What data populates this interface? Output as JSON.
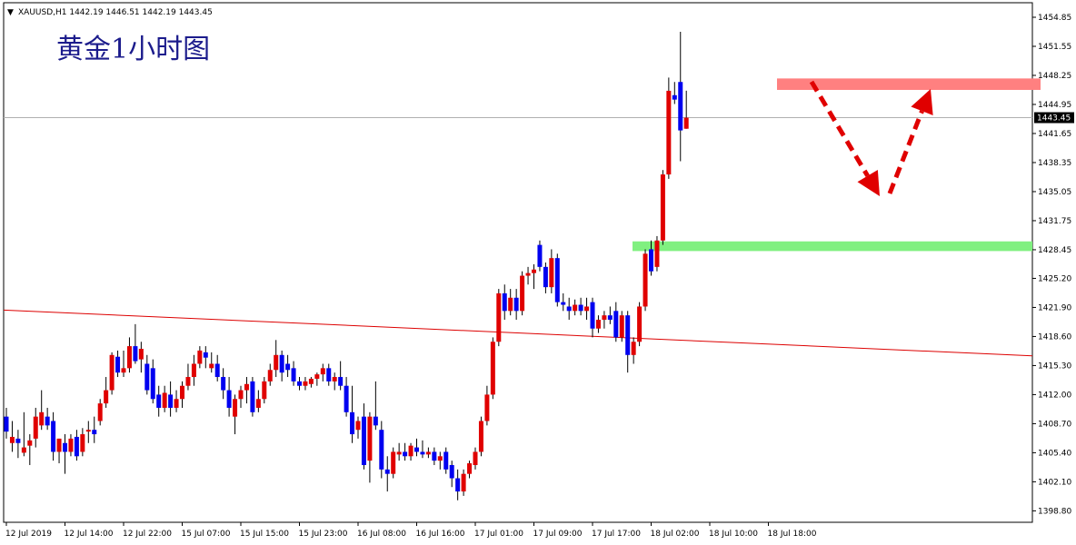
{
  "header": {
    "arrow": "▼",
    "symbol_text": "XAUUSD,H1  1442.19 1446.51 1442.19 1443.45"
  },
  "title": "黄金1小时图",
  "current_price": "1443.45",
  "colors": {
    "bull": "#e00000",
    "bear": "#0000f0",
    "wick": "#000000",
    "trendline": "#dd0000",
    "resistance_zone": "#ff8080",
    "support_zone": "#80f080",
    "arrow": "#e00000",
    "grid": "#000000",
    "price_tag_bg": "#000000"
  },
  "chart_data": {
    "type": "candlestick",
    "symbol": "XAUUSD",
    "timeframe": "H1",
    "ylim": [
      1397.5,
      1456.5
    ],
    "y_ticks": [
      "1454.85",
      "1451.55",
      "1448.25",
      "1444.95",
      "1441.65",
      "1438.35",
      "1435.05",
      "1431.75",
      "1428.45",
      "1425.20",
      "1421.90",
      "1418.60",
      "1415.30",
      "1412.00",
      "1408.70",
      "1405.40",
      "1402.10",
      "1398.80"
    ],
    "x_ticks": [
      "12 Jul 2019",
      "12 Jul 14:00",
      "12 Jul 22:00",
      "15 Jul 07:00",
      "15 Jul 15:00",
      "15 Jul 23:00",
      "16 Jul 08:00",
      "16 Jul 16:00",
      "17 Jul 01:00",
      "17 Jul 09:00",
      "17 Jul 17:00",
      "18 Jul 02:00",
      "18 Jul 10:00",
      "18 Jul 18:00"
    ],
    "candles": [
      {
        "o": 1409.5,
        "h": 1410.5,
        "l": 1407.0,
        "c": 1407.8
      },
      {
        "o": 1406.5,
        "h": 1409.0,
        "l": 1405.5,
        "c": 1407.2
      },
      {
        "o": 1407.0,
        "h": 1408.0,
        "l": 1404.8,
        "c": 1406.5
      },
      {
        "o": 1405.4,
        "h": 1410.0,
        "l": 1405.0,
        "c": 1406.0
      },
      {
        "o": 1406.2,
        "h": 1407.5,
        "l": 1404.0,
        "c": 1406.8
      },
      {
        "o": 1407.0,
        "h": 1410.5,
        "l": 1406.0,
        "c": 1409.5
      },
      {
        "o": 1408.5,
        "h": 1412.5,
        "l": 1408.0,
        "c": 1410.0
      },
      {
        "o": 1409.5,
        "h": 1410.5,
        "l": 1408.0,
        "c": 1408.5
      },
      {
        "o": 1409.0,
        "h": 1410.0,
        "l": 1404.5,
        "c": 1405.5
      },
      {
        "o": 1405.5,
        "h": 1407.0,
        "l": 1404.2,
        "c": 1407.0
      },
      {
        "o": 1406.5,
        "h": 1407.5,
        "l": 1403.0,
        "c": 1405.5
      },
      {
        "o": 1405.5,
        "h": 1407.5,
        "l": 1405.0,
        "c": 1407.0
      },
      {
        "o": 1407.2,
        "h": 1408.0,
        "l": 1404.5,
        "c": 1405.0
      },
      {
        "o": 1405.5,
        "h": 1408.2,
        "l": 1405.0,
        "c": 1407.5
      },
      {
        "o": 1407.8,
        "h": 1409.0,
        "l": 1406.5,
        "c": 1408.0
      },
      {
        "o": 1408.0,
        "h": 1409.5,
        "l": 1406.5,
        "c": 1407.5
      },
      {
        "o": 1409.0,
        "h": 1411.5,
        "l": 1408.5,
        "c": 1411.0
      },
      {
        "o": 1411.0,
        "h": 1414.0,
        "l": 1410.5,
        "c": 1412.5
      },
      {
        "o": 1412.5,
        "h": 1416.8,
        "l": 1412.0,
        "c": 1416.5
      },
      {
        "o": 1416.3,
        "h": 1417.0,
        "l": 1414.0,
        "c": 1414.5
      },
      {
        "o": 1414.5,
        "h": 1417.0,
        "l": 1414.0,
        "c": 1415.0
      },
      {
        "o": 1415.0,
        "h": 1418.5,
        "l": 1414.5,
        "c": 1417.5
      },
      {
        "o": 1417.5,
        "h": 1420.0,
        "l": 1415.5,
        "c": 1415.8
      },
      {
        "o": 1416.0,
        "h": 1418.0,
        "l": 1414.5,
        "c": 1417.2
      },
      {
        "o": 1415.5,
        "h": 1416.5,
        "l": 1412.0,
        "c": 1412.5
      },
      {
        "o": 1415.0,
        "h": 1416.0,
        "l": 1411.0,
        "c": 1411.5
      },
      {
        "o": 1412.0,
        "h": 1413.0,
        "l": 1409.5,
        "c": 1410.5
      },
      {
        "o": 1410.5,
        "h": 1413.0,
        "l": 1410.0,
        "c": 1412.2
      },
      {
        "o": 1412.0,
        "h": 1413.5,
        "l": 1409.5,
        "c": 1410.5
      },
      {
        "o": 1410.5,
        "h": 1412.5,
        "l": 1410.0,
        "c": 1411.5
      },
      {
        "o": 1411.5,
        "h": 1413.5,
        "l": 1410.5,
        "c": 1413.0
      },
      {
        "o": 1413.0,
        "h": 1415.5,
        "l": 1412.5,
        "c": 1414.0
      },
      {
        "o": 1414.0,
        "h": 1416.5,
        "l": 1413.0,
        "c": 1415.5
      },
      {
        "o": 1415.5,
        "h": 1417.5,
        "l": 1415.0,
        "c": 1417.0
      },
      {
        "o": 1416.8,
        "h": 1417.5,
        "l": 1415.0,
        "c": 1416.2
      },
      {
        "o": 1415.0,
        "h": 1416.8,
        "l": 1414.5,
        "c": 1415.5
      },
      {
        "o": 1415.5,
        "h": 1416.5,
        "l": 1413.5,
        "c": 1414.0
      },
      {
        "o": 1414.0,
        "h": 1415.0,
        "l": 1411.5,
        "c": 1412.5
      },
      {
        "o": 1412.5,
        "h": 1414.0,
        "l": 1409.5,
        "c": 1410.5
      },
      {
        "o": 1409.5,
        "h": 1412.0,
        "l": 1407.5,
        "c": 1411.5
      },
      {
        "o": 1411.5,
        "h": 1413.0,
        "l": 1410.5,
        "c": 1412.5
      },
      {
        "o": 1412.5,
        "h": 1414.0,
        "l": 1411.0,
        "c": 1413.2
      },
      {
        "o": 1413.5,
        "h": 1414.0,
        "l": 1409.5,
        "c": 1410.0
      },
      {
        "o": 1410.5,
        "h": 1412.5,
        "l": 1410.0,
        "c": 1411.5
      },
      {
        "o": 1411.5,
        "h": 1414.0,
        "l": 1411.0,
        "c": 1413.5
      },
      {
        "o": 1413.5,
        "h": 1415.5,
        "l": 1413.0,
        "c": 1414.8
      },
      {
        "o": 1414.8,
        "h": 1418.2,
        "l": 1414.0,
        "c": 1416.5
      },
      {
        "o": 1416.5,
        "h": 1417.0,
        "l": 1413.5,
        "c": 1414.5
      },
      {
        "o": 1415.5,
        "h": 1416.5,
        "l": 1414.0,
        "c": 1414.8
      },
      {
        "o": 1415.0,
        "h": 1415.8,
        "l": 1413.0,
        "c": 1413.5
      },
      {
        "o": 1413.5,
        "h": 1414.0,
        "l": 1412.5,
        "c": 1413.0
      },
      {
        "o": 1413.0,
        "h": 1414.0,
        "l": 1412.5,
        "c": 1413.5
      },
      {
        "o": 1413.2,
        "h": 1414.0,
        "l": 1412.8,
        "c": 1413.8
      },
      {
        "o": 1413.8,
        "h": 1414.5,
        "l": 1413.0,
        "c": 1414.3
      },
      {
        "o": 1414.3,
        "h": 1415.5,
        "l": 1413.5,
        "c": 1415.0
      },
      {
        "o": 1415.0,
        "h": 1415.5,
        "l": 1413.0,
        "c": 1413.5
      },
      {
        "o": 1413.5,
        "h": 1414.5,
        "l": 1412.5,
        "c": 1414.0
      },
      {
        "o": 1414.0,
        "h": 1415.8,
        "l": 1412.5,
        "c": 1413.0
      },
      {
        "o": 1413.0,
        "h": 1414.0,
        "l": 1409.5,
        "c": 1410.0
      },
      {
        "o": 1410.0,
        "h": 1413.0,
        "l": 1406.5,
        "c": 1407.5
      },
      {
        "o": 1408.0,
        "h": 1409.5,
        "l": 1407.0,
        "c": 1409.0
      },
      {
        "o": 1409.5,
        "h": 1411.0,
        "l": 1403.5,
        "c": 1404.0
      },
      {
        "o": 1404.5,
        "h": 1410.0,
        "l": 1402.0,
        "c": 1409.5
      },
      {
        "o": 1409.5,
        "h": 1413.5,
        "l": 1408.0,
        "c": 1408.5
      },
      {
        "o": 1408.0,
        "h": 1409.0,
        "l": 1402.5,
        "c": 1403.5
      },
      {
        "o": 1403.5,
        "h": 1405.0,
        "l": 1401.0,
        "c": 1403.0
      },
      {
        "o": 1403.0,
        "h": 1406.0,
        "l": 1402.5,
        "c": 1405.5
      },
      {
        "o": 1405.2,
        "h": 1406.5,
        "l": 1404.5,
        "c": 1405.5
      },
      {
        "o": 1405.5,
        "h": 1406.5,
        "l": 1404.5,
        "c": 1405.0
      },
      {
        "o": 1405.0,
        "h": 1406.5,
        "l": 1404.5,
        "c": 1406.2
      },
      {
        "o": 1406.0,
        "h": 1407.0,
        "l": 1405.0,
        "c": 1405.5
      },
      {
        "o": 1405.5,
        "h": 1406.8,
        "l": 1404.8,
        "c": 1405.2
      },
      {
        "o": 1405.2,
        "h": 1406.0,
        "l": 1404.8,
        "c": 1405.5
      },
      {
        "o": 1405.5,
        "h": 1406.0,
        "l": 1404.0,
        "c": 1404.5
      },
      {
        "o": 1404.5,
        "h": 1405.5,
        "l": 1403.5,
        "c": 1405.0
      },
      {
        "o": 1405.5,
        "h": 1406.0,
        "l": 1403.0,
        "c": 1403.5
      },
      {
        "o": 1404.0,
        "h": 1404.5,
        "l": 1401.5,
        "c": 1402.5
      },
      {
        "o": 1402.5,
        "h": 1403.5,
        "l": 1400.0,
        "c": 1401.0
      },
      {
        "o": 1401.0,
        "h": 1403.5,
        "l": 1400.5,
        "c": 1403.0
      },
      {
        "o": 1403.0,
        "h": 1404.5,
        "l": 1402.5,
        "c": 1404.2
      },
      {
        "o": 1404.0,
        "h": 1406.0,
        "l": 1403.5,
        "c": 1405.5
      },
      {
        "o": 1405.5,
        "h": 1409.5,
        "l": 1405.0,
        "c": 1409.0
      },
      {
        "o": 1409.0,
        "h": 1413.0,
        "l": 1408.5,
        "c": 1412.0
      },
      {
        "o": 1412.0,
        "h": 1418.5,
        "l": 1411.5,
        "c": 1418.0
      },
      {
        "o": 1418.0,
        "h": 1424.0,
        "l": 1417.5,
        "c": 1423.5
      },
      {
        "o": 1423.5,
        "h": 1424.5,
        "l": 1420.5,
        "c": 1421.5
      },
      {
        "o": 1421.5,
        "h": 1424.0,
        "l": 1421.0,
        "c": 1423.0
      },
      {
        "o": 1423.0,
        "h": 1424.0,
        "l": 1420.5,
        "c": 1421.5
      },
      {
        "o": 1421.5,
        "h": 1426.0,
        "l": 1421.0,
        "c": 1425.5
      },
      {
        "o": 1425.5,
        "h": 1426.5,
        "l": 1424.5,
        "c": 1425.8
      },
      {
        "o": 1425.8,
        "h": 1426.8,
        "l": 1424.0,
        "c": 1426.2
      },
      {
        "o": 1429.0,
        "h": 1429.5,
        "l": 1426.0,
        "c": 1426.5
      },
      {
        "o": 1426.5,
        "h": 1427.0,
        "l": 1423.5,
        "c": 1424.2
      },
      {
        "o": 1424.2,
        "h": 1428.5,
        "l": 1423.5,
        "c": 1427.5
      },
      {
        "o": 1427.5,
        "h": 1428.0,
        "l": 1422.0,
        "c": 1422.5
      },
      {
        "o": 1422.5,
        "h": 1423.5,
        "l": 1421.5,
        "c": 1422.2
      },
      {
        "o": 1422.0,
        "h": 1423.0,
        "l": 1420.5,
        "c": 1421.5
      },
      {
        "o": 1421.5,
        "h": 1422.8,
        "l": 1421.0,
        "c": 1422.2
      },
      {
        "o": 1422.2,
        "h": 1423.0,
        "l": 1421.0,
        "c": 1421.5
      },
      {
        "o": 1421.5,
        "h": 1423.0,
        "l": 1420.5,
        "c": 1422.0
      },
      {
        "o": 1422.5,
        "h": 1423.0,
        "l": 1418.5,
        "c": 1419.5
      },
      {
        "o": 1419.5,
        "h": 1421.0,
        "l": 1419.0,
        "c": 1420.5
      },
      {
        "o": 1420.5,
        "h": 1421.5,
        "l": 1419.5,
        "c": 1421.0
      },
      {
        "o": 1421.0,
        "h": 1422.0,
        "l": 1420.0,
        "c": 1420.5
      },
      {
        "o": 1421.5,
        "h": 1422.5,
        "l": 1418.0,
        "c": 1418.5
      },
      {
        "o": 1418.5,
        "h": 1421.5,
        "l": 1418.0,
        "c": 1421.0
      },
      {
        "o": 1421.0,
        "h": 1421.5,
        "l": 1414.5,
        "c": 1416.5
      },
      {
        "o": 1416.5,
        "h": 1418.5,
        "l": 1415.5,
        "c": 1418.0
      },
      {
        "o": 1418.0,
        "h": 1422.5,
        "l": 1417.5,
        "c": 1422.0
      },
      {
        "o": 1422.0,
        "h": 1428.5,
        "l": 1421.5,
        "c": 1428.0
      },
      {
        "o": 1428.5,
        "h": 1429.5,
        "l": 1425.5,
        "c": 1426.0
      },
      {
        "o": 1426.5,
        "h": 1430.0,
        "l": 1426.0,
        "c": 1429.5
      },
      {
        "o": 1429.5,
        "h": 1437.5,
        "l": 1429.0,
        "c": 1437.0
      },
      {
        "o": 1437.0,
        "h": 1448.0,
        "l": 1436.5,
        "c": 1446.5
      },
      {
        "o": 1446.0,
        "h": 1447.5,
        "l": 1445.0,
        "c": 1445.5
      },
      {
        "o": 1447.5,
        "h": 1453.2,
        "l": 1438.5,
        "c": 1442.0
      },
      {
        "o": 1442.19,
        "h": 1446.51,
        "l": 1442.19,
        "c": 1443.45
      }
    ],
    "annotations": {
      "resistance_zone": [
        1446.6,
        1447.9
      ],
      "support_zone": [
        1428.3,
        1429.4
      ],
      "trendline_price": [
        1421.6,
        1416.4
      ]
    }
  }
}
